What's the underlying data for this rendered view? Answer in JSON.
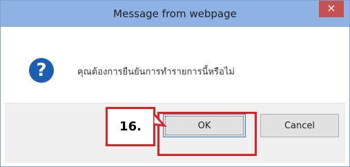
{
  "dialog": {
    "title": "Message from webpage",
    "close_glyph": "×",
    "message": "คุณต้องการยืนยันการทำรายการนี้หรือไม่",
    "buttons": {
      "ok": "OK",
      "cancel": "Cancel"
    }
  },
  "annotation": {
    "step_label": "16."
  },
  "colors": {
    "titlebar": "#8db2e3",
    "close_button": "#c75050",
    "icon": "#1a5fb4",
    "highlight": "#e02020"
  },
  "icons": {
    "message_icon": "question-icon",
    "close": "close-icon"
  }
}
